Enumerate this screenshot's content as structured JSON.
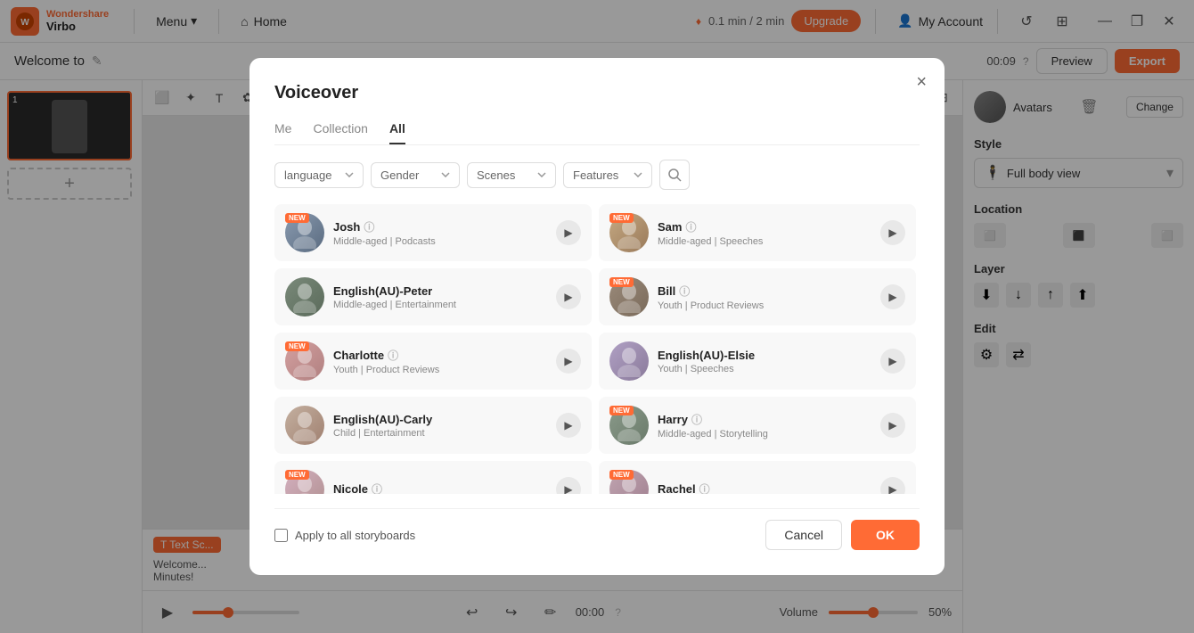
{
  "app": {
    "name": "Virbo",
    "brand": "Wondershare",
    "logo_letter": "W"
  },
  "topbar": {
    "menu_label": "Menu",
    "home_label": "Home",
    "timer": "0.1 min / 2 min",
    "upgrade_label": "Upgrade",
    "myaccount_label": "My Account",
    "time_display": "00:09",
    "preview_label": "Preview",
    "export_label": "Export"
  },
  "secondbar": {
    "welcome_text": "Welcome to"
  },
  "modal": {
    "title": "Voiceover",
    "close_label": "×",
    "tabs": [
      {
        "label": "Me",
        "id": "me"
      },
      {
        "label": "Collection",
        "id": "collection"
      },
      {
        "label": "All",
        "id": "all",
        "active": true
      }
    ],
    "filters": {
      "language_label": "language",
      "gender_label": "Gender",
      "scenes_label": "Scenes",
      "features_label": "Features"
    },
    "voices": [
      {
        "id": "josh",
        "name": "Josh",
        "desc": "Middle-aged | Podcasts",
        "new": true,
        "col": "left"
      },
      {
        "id": "sam",
        "name": "Sam",
        "desc": "Middle-aged | Speeches",
        "new": true,
        "col": "right"
      },
      {
        "id": "peter",
        "name": "English(AU)-Peter",
        "desc": "Middle-aged | Entertainment",
        "new": false,
        "col": "left"
      },
      {
        "id": "bill",
        "name": "Bill",
        "desc": "Youth | Product Reviews",
        "new": true,
        "col": "right"
      },
      {
        "id": "charlotte",
        "name": "Charlotte",
        "desc": "Youth | Product Reviews",
        "new": true,
        "col": "left"
      },
      {
        "id": "elsie",
        "name": "English(AU)-Elsie",
        "desc": "Youth | Speeches",
        "new": false,
        "col": "right"
      },
      {
        "id": "carly",
        "name": "English(AU)-Carly",
        "desc": "Child | Entertainment",
        "new": false,
        "col": "left"
      },
      {
        "id": "harry",
        "name": "Harry",
        "desc": "Middle-aged | Storytelling",
        "new": true,
        "col": "right"
      },
      {
        "id": "nicole",
        "name": "Nicole",
        "desc": "",
        "new": true,
        "col": "left"
      },
      {
        "id": "rachel",
        "name": "Rachel",
        "desc": "",
        "new": true,
        "col": "right"
      }
    ],
    "footer": {
      "apply_all_label": "Apply to all storyboards",
      "cancel_label": "Cancel",
      "ok_label": "OK"
    }
  },
  "right_panel": {
    "avatars_label": "Avatars",
    "change_label": "Change",
    "style_label": "Style",
    "full_body_view": "Full body view",
    "location_label": "Location",
    "layer_label": "Layer",
    "edit_label": "Edit"
  },
  "playback": {
    "time": "00:00",
    "volume_label": "Volume",
    "volume_pct": "50%"
  }
}
